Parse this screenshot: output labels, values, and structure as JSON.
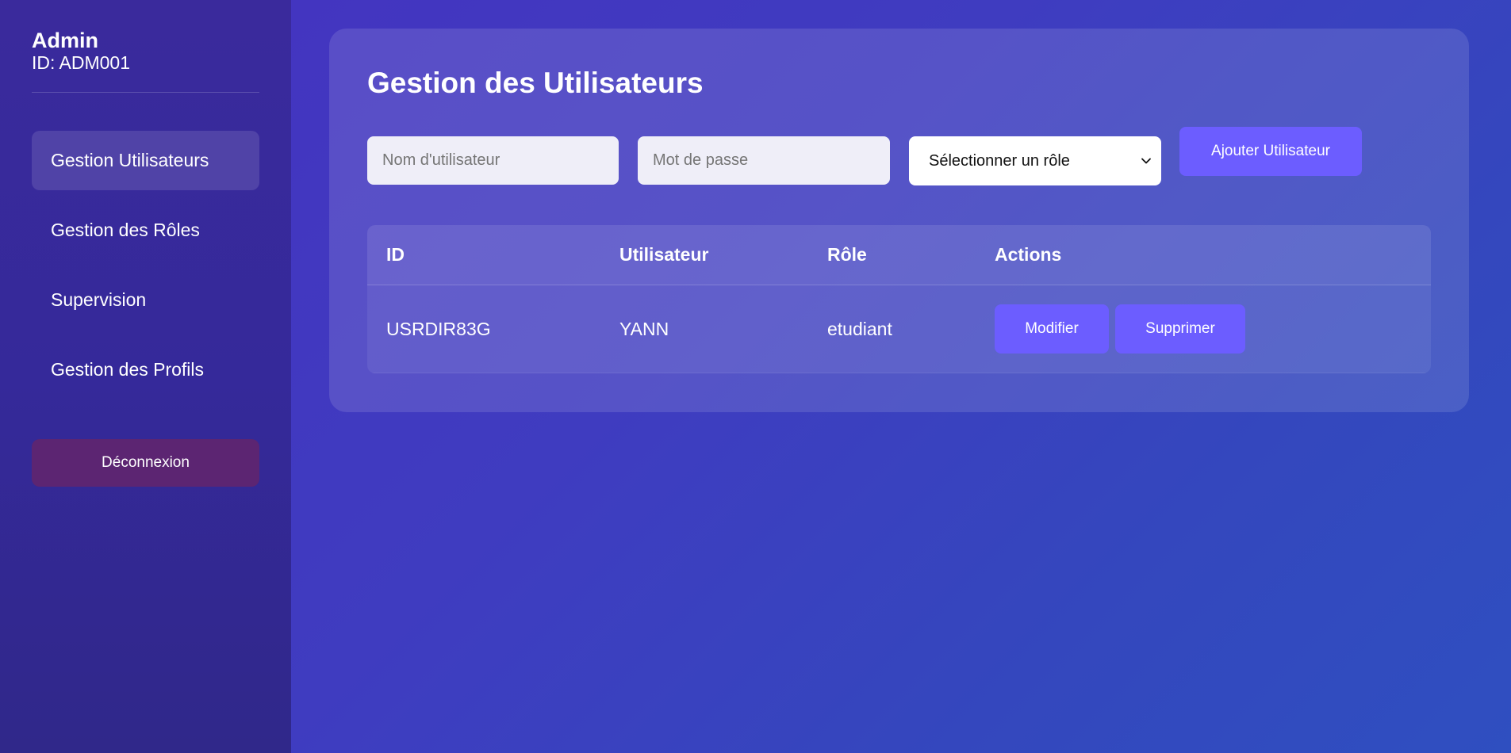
{
  "sidebar": {
    "user": {
      "name": "Admin",
      "id_label": "ID: ADM001"
    },
    "items": [
      {
        "label": "Gestion Utilisateurs",
        "active": true
      },
      {
        "label": "Gestion des Rôles",
        "active": false
      },
      {
        "label": "Supervision",
        "active": false
      },
      {
        "label": "Gestion des Profils",
        "active": false
      }
    ],
    "logout_label": "Déconnexion"
  },
  "main": {
    "title": "Gestion des Utilisateurs",
    "form": {
      "username_placeholder": "Nom d'utilisateur",
      "password_placeholder": "Mot de passe",
      "role_select_value": "Sélectionner un rôle",
      "add_button_label": "Ajouter Utilisateur"
    },
    "table": {
      "headers": [
        "ID",
        "Utilisateur",
        "Rôle",
        "Actions"
      ],
      "rows": [
        {
          "id": "USRDIR83G",
          "username": "YANN",
          "role": "etudiant",
          "edit_label": "Modifier",
          "delete_label": "Supprimer"
        }
      ]
    }
  },
  "colors": {
    "accent": "#6c5dff",
    "logout": "#5c2572",
    "sidebar": "#35299a",
    "background": "#3f3cc0"
  }
}
